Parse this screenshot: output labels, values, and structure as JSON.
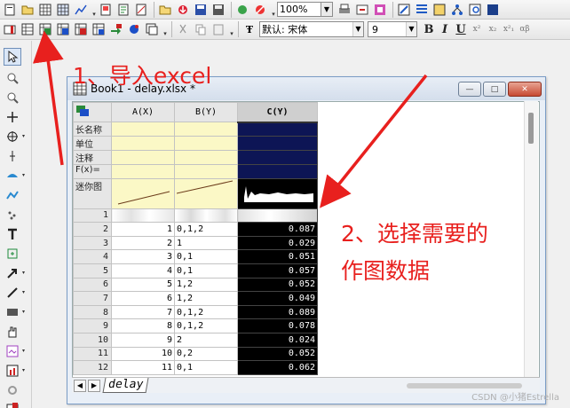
{
  "toolbar": {
    "zoom_value": "100%",
    "font_name": "默认: 宋体",
    "font_size": "9",
    "bold_label": "B",
    "italic_label": "I",
    "underline_label": "U"
  },
  "window": {
    "title": "Book1 - delay.xlsx *",
    "minimize_label": "—",
    "restore_label": "□",
    "close_label": "✕"
  },
  "sheet": {
    "columns": [
      "A(X)",
      "B(Y)",
      "C(Y)"
    ],
    "meta_rows": [
      "长名称",
      "单位",
      "注释",
      "F(x)=",
      "迷你图"
    ],
    "rows": [
      {
        "n": "1",
        "a": "",
        "b": "",
        "c": ""
      },
      {
        "n": "2",
        "a": "1",
        "b": "0,1,2",
        "c": "0.087"
      },
      {
        "n": "3",
        "a": "2",
        "b": "1",
        "c": "0.029"
      },
      {
        "n": "4",
        "a": "3",
        "b": "0,1",
        "c": "0.051"
      },
      {
        "n": "5",
        "a": "4",
        "b": "0,1",
        "c": "0.057"
      },
      {
        "n": "6",
        "a": "5",
        "b": "1,2",
        "c": "0.052"
      },
      {
        "n": "7",
        "a": "6",
        "b": "1,2",
        "c": "0.049"
      },
      {
        "n": "8",
        "a": "7",
        "b": "0,1,2",
        "c": "0.089"
      },
      {
        "n": "9",
        "a": "8",
        "b": "0,1,2",
        "c": "0.078"
      },
      {
        "n": "10",
        "a": "9",
        "b": "2",
        "c": "0.024"
      },
      {
        "n": "11",
        "a": "10",
        "b": "0,2",
        "c": "0.052"
      },
      {
        "n": "12",
        "a": "11",
        "b": "0,1",
        "c": "0.062"
      }
    ],
    "tab_name": "delay"
  },
  "annotations": {
    "step1": "1、导入excel",
    "step2_line1": "2、选择需要的",
    "step2_line2": "作图数据",
    "color": "#e8201e"
  },
  "watermark": "CSDN @小猪Estrella"
}
